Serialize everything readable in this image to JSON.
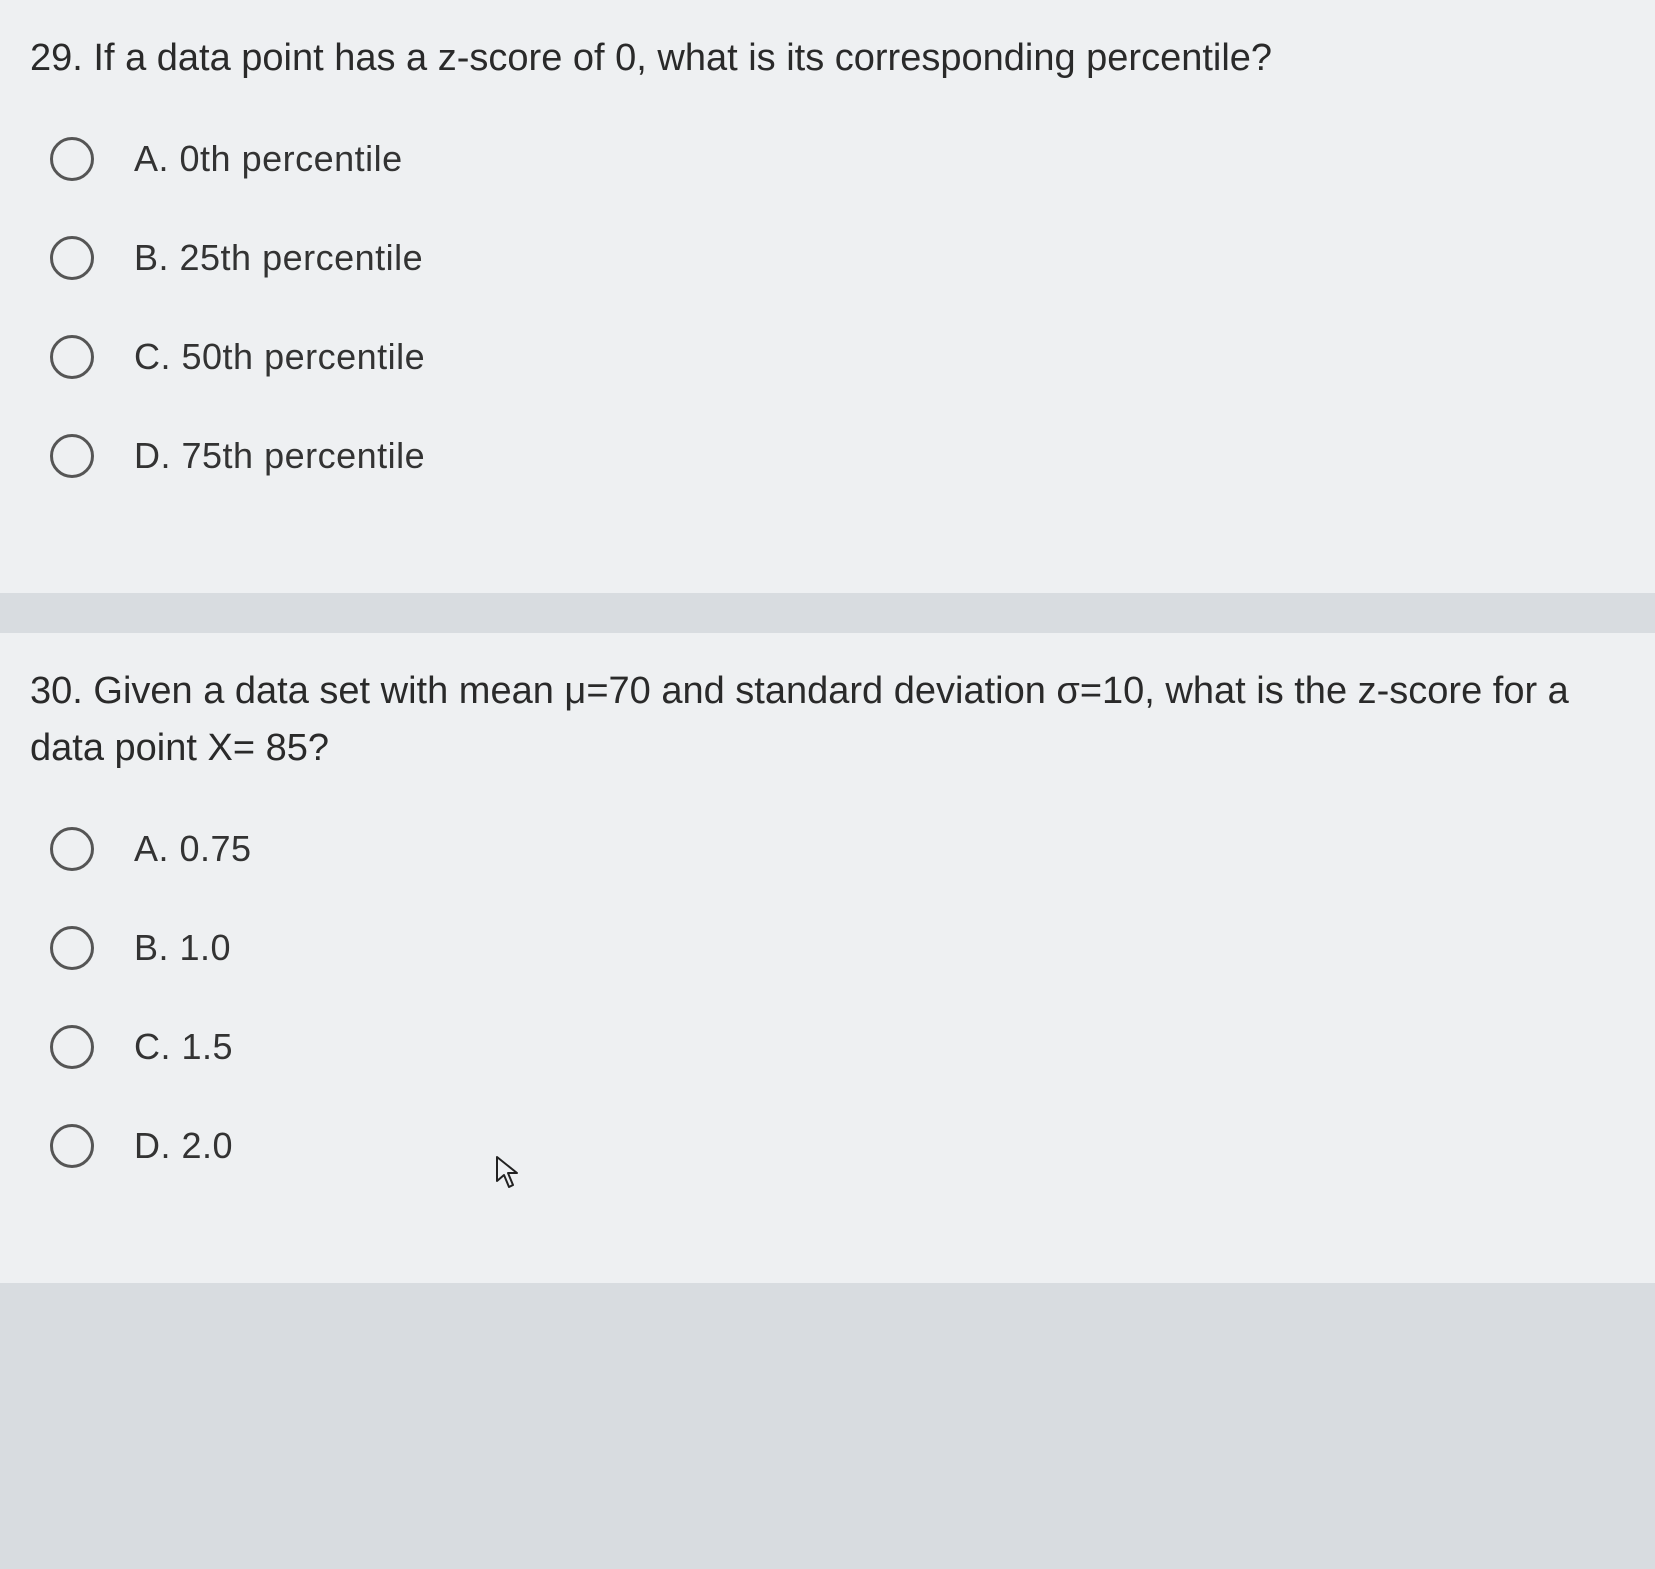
{
  "questions": [
    {
      "number": "29.",
      "text": "If a data point has a z-score of 0, what is its corresponding percentile?",
      "options": [
        {
          "label": "A. 0th percentile"
        },
        {
          "label": "B.  25th percentile"
        },
        {
          "label": "C. 50th percentile"
        },
        {
          "label": "D. 75th percentile"
        }
      ]
    },
    {
      "number": "30.",
      "text": "Given a data set with mean μ=70 and standard deviation σ=10, what is the z-score for a data point X= 85?",
      "options": [
        {
          "label": "A.  0.75"
        },
        {
          "label": "B.  1.0"
        },
        {
          "label": "C. 1.5"
        },
        {
          "label": "D. 2.0"
        }
      ]
    }
  ]
}
